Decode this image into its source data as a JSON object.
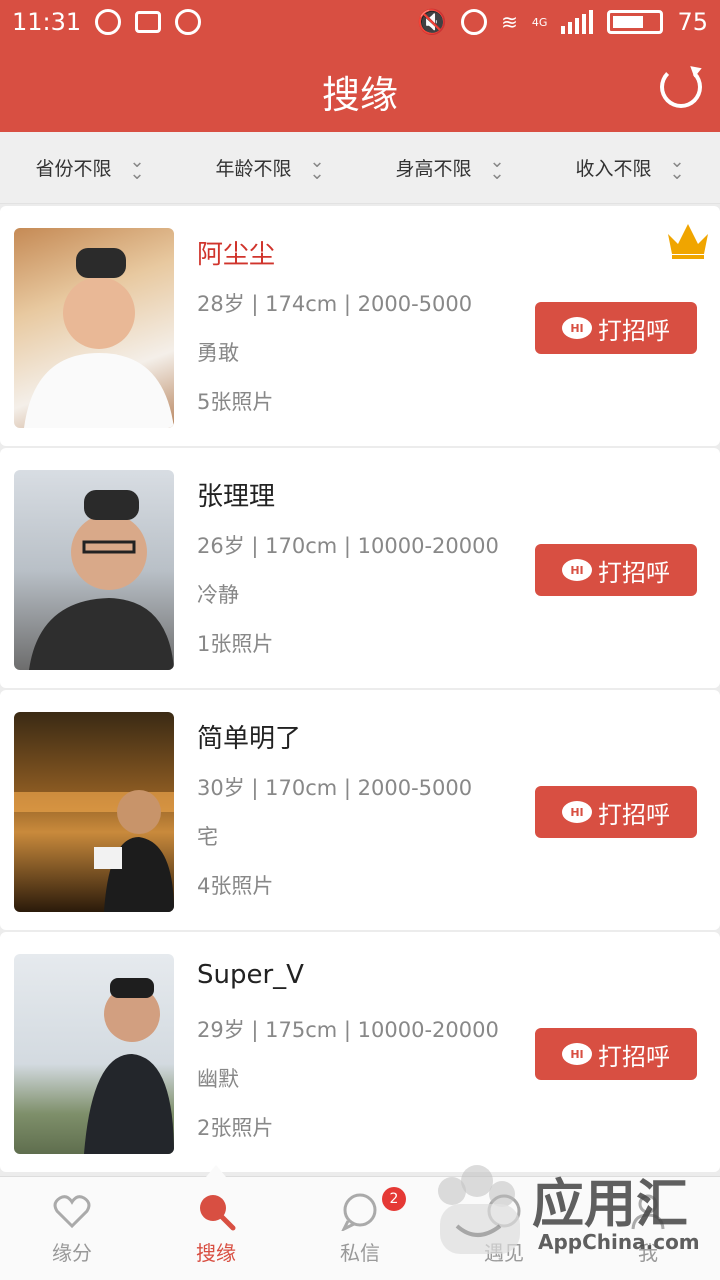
{
  "status_bar": {
    "time": "11:31",
    "network": "4G",
    "battery": "75"
  },
  "header": {
    "title": "搜缘"
  },
  "filters": [
    "省份不限",
    "年龄不限",
    "身高不限",
    "收入不限"
  ],
  "users": [
    {
      "name": "阿尘尘",
      "vip": true,
      "info": "28岁 | 174cm | 2000-5000",
      "trait": "勇敢",
      "photos": "5张照片",
      "greet": "打招呼"
    },
    {
      "name": "张理理",
      "vip": false,
      "info": "26岁 | 170cm | 10000-20000",
      "trait": "冷静",
      "photos": "1张照片",
      "greet": "打招呼"
    },
    {
      "name": "简单明了",
      "vip": false,
      "info": "30岁 | 170cm | 2000-5000",
      "trait": "宅",
      "photos": "4张照片",
      "greet": "打招呼"
    },
    {
      "name": "Super_V",
      "vip": false,
      "info": "29岁 | 175cm | 10000-20000",
      "trait": "幽默",
      "photos": "2张照片",
      "greet": "打招呼"
    }
  ],
  "tabs": [
    {
      "label": "缘分",
      "icon": "heart-icon"
    },
    {
      "label": "搜缘",
      "icon": "search-icon",
      "active": true
    },
    {
      "label": "私信",
      "icon": "chat-icon",
      "badge": "2"
    },
    {
      "label": "遇见",
      "icon": "meet-icon"
    },
    {
      "label": "我",
      "icon": "user-icon"
    }
  ],
  "watermark": {
    "text": "应用汇",
    "sub": "AppChina.com"
  },
  "colors": {
    "accent": "#d84f42",
    "vip_name": "#d0342c",
    "crown": "#f0a500"
  }
}
